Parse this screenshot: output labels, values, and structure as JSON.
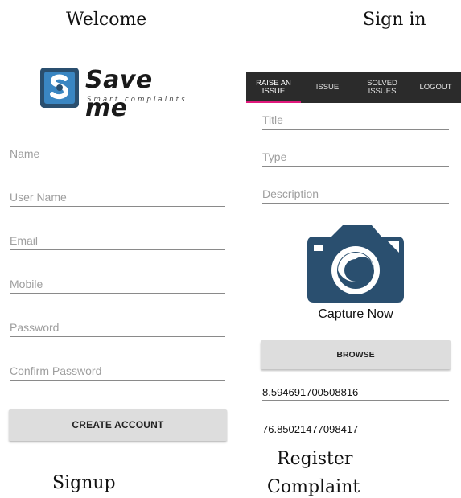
{
  "captions": {
    "welcome": "Welcome",
    "signin": "Sign in",
    "signup": "Signup",
    "register_line1": "Register",
    "register_line2": "Complaint"
  },
  "logo": {
    "title": "Save me",
    "subtitle": "Smart complaints"
  },
  "signup_form": {
    "name_placeholder": "Name",
    "username_placeholder": "User Name",
    "email_placeholder": "Email",
    "mobile_placeholder": "Mobile",
    "password_placeholder": "Password",
    "confirm_password_placeholder": "Confirm Password",
    "create_button": "CREATE ACCOUNT"
  },
  "tabs": [
    {
      "label": "RAISE AN ISSUE",
      "active": true
    },
    {
      "label": "ISSUE",
      "active": false
    },
    {
      "label": "SOLVED ISSUES",
      "active": false
    },
    {
      "label": "LOGOUT",
      "active": false
    }
  ],
  "complaint_form": {
    "title_placeholder": "Title",
    "type_placeholder": "Type",
    "description_placeholder": "Description",
    "capture_label": "Capture Now",
    "browse_button": "BROWSE",
    "latitude": "8.594691700508816",
    "longitude": "76.85021477098417"
  },
  "colors": {
    "tab_bar": "#2b2b2b",
    "tab_indicator": "#e0197d",
    "camera": "#2a4f6f",
    "logo": "#2a4f6f",
    "button": "#dddddd"
  }
}
